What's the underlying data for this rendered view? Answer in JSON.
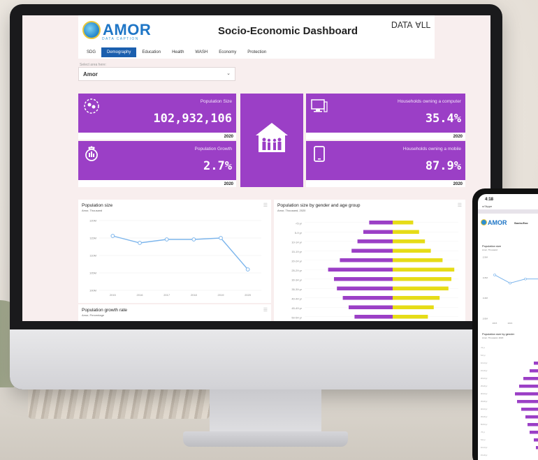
{
  "app": {
    "logo_text": "AMOR",
    "logo_subtitle": "DATA CAPTION",
    "title": "Socio-Economic Dashboard",
    "partner_logo": "DATA ∀LL"
  },
  "tabs": [
    {
      "label": "SDG",
      "active": false
    },
    {
      "label": "Demography",
      "active": true
    },
    {
      "label": "Education",
      "active": false
    },
    {
      "label": "Health",
      "active": false
    },
    {
      "label": "WASH",
      "active": false
    },
    {
      "label": "Economy",
      "active": false
    },
    {
      "label": "Protection",
      "active": false
    }
  ],
  "area_select": {
    "label": "Select area here:",
    "value": "Amor"
  },
  "cards": [
    {
      "title": "Population Size",
      "value": "102,932,106",
      "year": "2020",
      "icon": "population-icon"
    },
    {
      "title": "Population Growth",
      "value": "2.7%",
      "year": "2020",
      "icon": "growth-icon"
    },
    {
      "title": "Households owning a computer",
      "value": "35.4%",
      "year": "2020",
      "icon": "computer-icon"
    },
    {
      "title": "Households owning a mobile",
      "value": "87.9%",
      "year": "2020",
      "icon": "mobile-icon"
    }
  ],
  "center_icon": "household-icon",
  "colors": {
    "accent_purple": "#9b3fc6",
    "accent_yellow": "#e6dc17",
    "tab_active": "#1b5fae",
    "line_blue": "#7cb5ec"
  },
  "panels": {
    "pop_size": {
      "title": "Population size",
      "subtitle": "Amor, Thousand"
    },
    "pyramid": {
      "title": "Population size by gender and age group",
      "subtitle": "Amor, Thousand, 2020"
    },
    "growth": {
      "title": "Population growth rate",
      "subtitle": "Amor, Percentage"
    }
  },
  "chart_data": [
    {
      "type": "line",
      "title": "Population size",
      "x": [
        "2015",
        "2016",
        "2017",
        "2018",
        "2019",
        "2020"
      ],
      "values": [
        115.6,
        113.6,
        114.6,
        114.6,
        115.0,
        106.0
      ],
      "y_ticks": [
        "120M",
        "115M",
        "110M",
        "105M",
        "100M"
      ],
      "ylim": [
        100,
        120
      ],
      "grid": true
    },
    {
      "type": "bar",
      "title": "Population size by gender and age group",
      "orientation": "horizontal",
      "categories": [
        "<5 yr",
        "5-9 yr",
        "10-14 yr",
        "15-19 yr",
        "20-24 yr",
        "25-29 yr",
        "30-34 yr",
        "35-39 yr",
        "40-44 yr",
        "45-49 yr",
        "50-54 yr"
      ],
      "series": [
        {
          "values": [
            -8,
            -10,
            -12,
            -14,
            -18,
            -22,
            -20,
            -19,
            -17,
            -15,
            -13
          ]
        },
        {
          "values": [
            7,
            9,
            11,
            13,
            17,
            21,
            20,
            19,
            16,
            14,
            12
          ]
        }
      ]
    }
  ],
  "phone": {
    "time": "4:18",
    "back_label": "◂ Skype",
    "logo_text": "AMOR",
    "title": "Socio-Eco",
    "panel1_title": "Population size",
    "panel1_subtitle": "Amor, Thousand",
    "panel1_ticks": [
      "120M",
      "115M",
      "110M",
      "105M"
    ],
    "panel1_x": [
      "2015",
      "2016"
    ],
    "panel2_title": "Population size by gender",
    "panel2_subtitle": "Amor, Thousand, 2020",
    "bars": [
      4,
      6,
      8,
      10,
      13,
      15,
      17,
      16,
      14,
      12,
      11,
      10,
      8,
      7,
      6
    ]
  }
}
